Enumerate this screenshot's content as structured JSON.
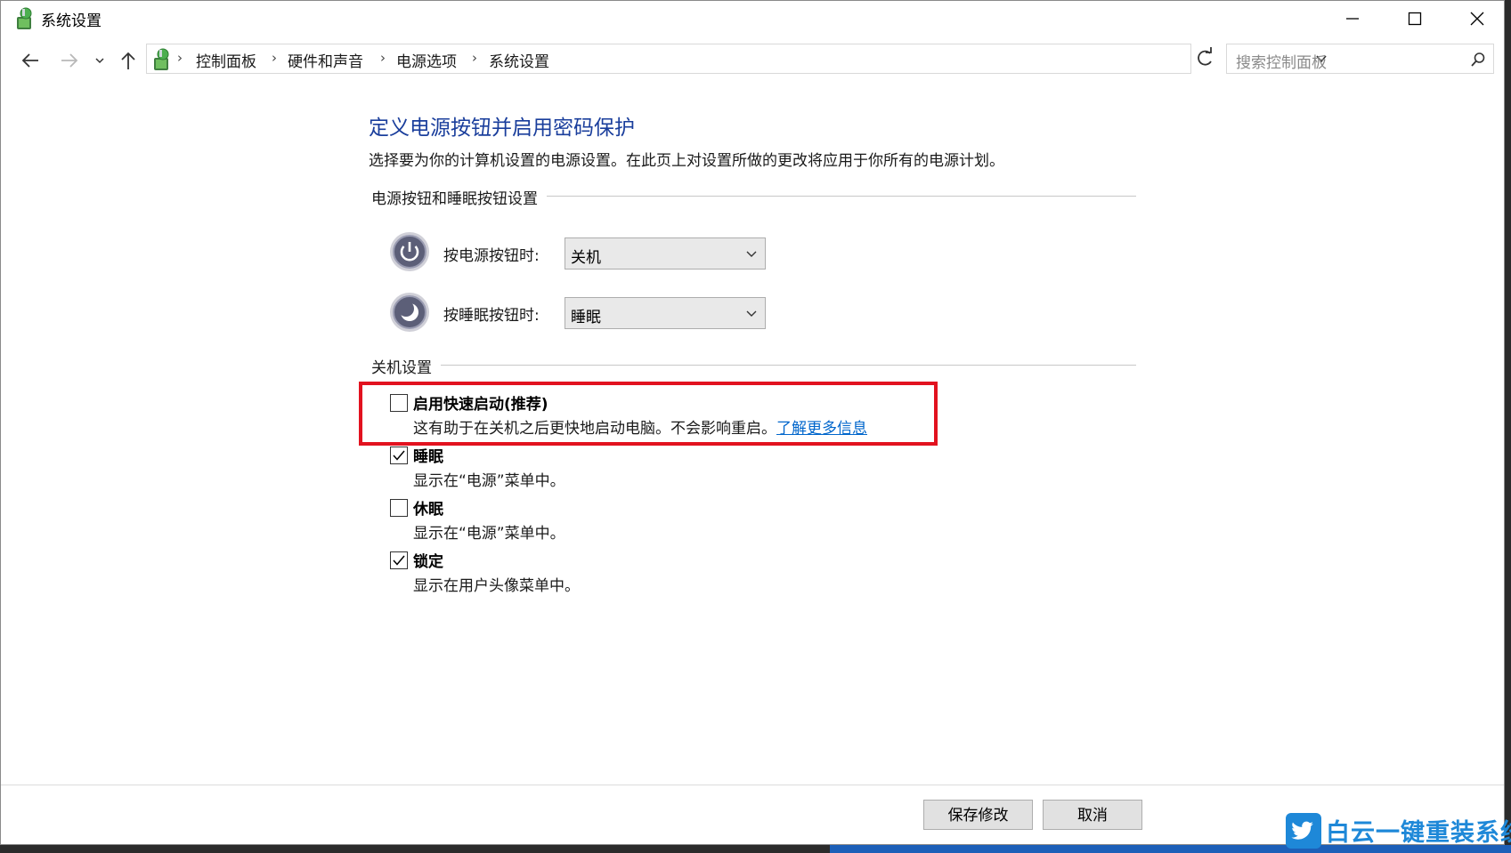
{
  "window": {
    "title": "系统设置"
  },
  "breadcrumb": [
    "控制面板",
    "硬件和声音",
    "电源选项",
    "系统设置"
  ],
  "search": {
    "placeholder": "搜索控制面板"
  },
  "content": {
    "heading": "定义电源按钮并启用密码保护",
    "description": "选择要为你的计算机设置的电源设置。在此页上对设置所做的更改将应用于你所有的电源计划。",
    "power_group_label": "电源按钮和睡眠按钮设置",
    "power_button_label": "按电源按钮时:",
    "power_button_value": "关机",
    "sleep_button_label": "按睡眠按钮时:",
    "sleep_button_value": "睡眠",
    "shutdown_group_label": "关机设置",
    "options": [
      {
        "title": "启用快速启动(推荐)",
        "desc": "这有助于在关机之后更快地启动电脑。不会影响重启。",
        "link": "了解更多信息",
        "checked": false
      },
      {
        "title": "睡眠",
        "desc": "显示在“电源”菜单中。",
        "checked": true
      },
      {
        "title": "休眠",
        "desc": "显示在“电源”菜单中。",
        "checked": false
      },
      {
        "title": "锁定",
        "desc": "显示在用户头像菜单中。",
        "checked": true
      }
    ]
  },
  "footer": {
    "save_label": "保存修改",
    "cancel_label": "取消"
  },
  "watermark": {
    "text": "白云一键重装系统"
  },
  "colors": {
    "heading": "#1a3e9c",
    "link": "#0066cc",
    "highlight": "#e2121f",
    "watermark": "#1e88d8"
  },
  "icons": {
    "app": "control-panel-icon",
    "power": "power-icon",
    "sleep": "moon-icon"
  }
}
